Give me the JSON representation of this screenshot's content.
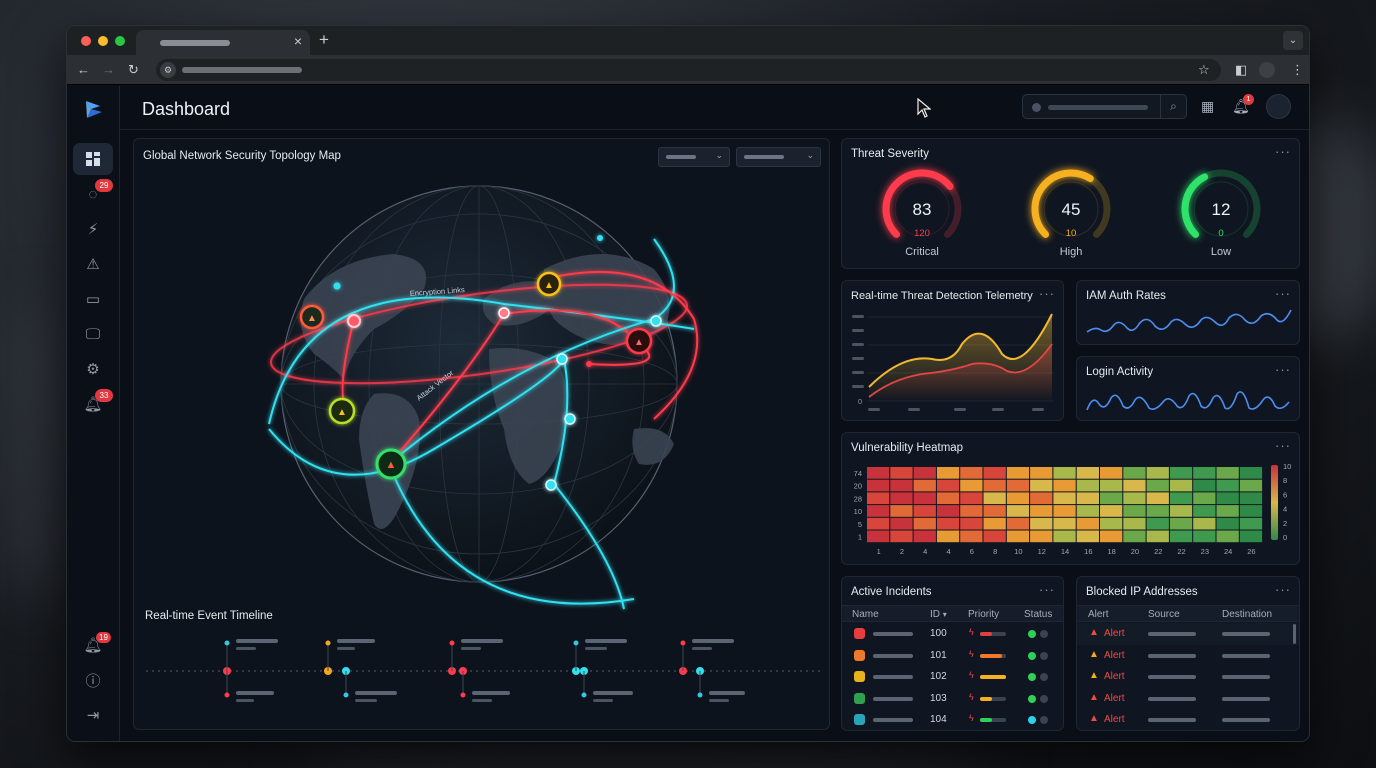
{
  "app": {
    "page_title": "Dashboard"
  },
  "sidebar": {
    "badges": {
      "shield": "29",
      "bell": "33",
      "notifications": "19"
    }
  },
  "header": {
    "notification_badge": "1"
  },
  "map": {
    "title": "Global Network Security Topology Map",
    "annotation_1": "Encryption Links",
    "annotation_2": "Attack Vector"
  },
  "timeline": {
    "title": "Real-time Event Timeline"
  },
  "severity": {
    "title": "Threat Severity",
    "gauges": [
      {
        "label": "Critical",
        "value": "83",
        "sub": "120",
        "fraction": 0.69,
        "color": "#ff3b4c"
      },
      {
        "label": "High",
        "value": "45",
        "sub": "10",
        "fraction": 0.62,
        "color": "#f7b01f"
      },
      {
        "label": "Low",
        "value": "12",
        "sub": "0",
        "fraction": 0.4,
        "color": "#2ee36a"
      }
    ]
  },
  "telemetry": {
    "title": "Real-time Threat Detection Telemetry",
    "y_ticks": [
      "0"
    ]
  },
  "iam": {
    "title": "IAM Auth Rates"
  },
  "login": {
    "title": "Login Activity"
  },
  "heatmap": {
    "title": "Vulnerability Heatmap",
    "y_labels": [
      "74",
      "20",
      "28",
      "10",
      "5",
      "1"
    ],
    "x_labels": [
      "1",
      "2",
      "4",
      "4",
      "6",
      "8",
      "10",
      "12",
      "14",
      "16",
      "18",
      "20",
      "22",
      "22",
      "23",
      "24",
      "26"
    ],
    "scale_labels": [
      "10",
      "8",
      "6",
      "4",
      "2",
      "0"
    ]
  },
  "incidents": {
    "title": "Active Incidents",
    "columns": {
      "name": "Name",
      "id": "ID",
      "priority": "Priority",
      "status": "Status"
    },
    "sort_indicator": "▾",
    "rows": [
      {
        "id": "100",
        "icon_color": "#e53e3e",
        "bar_color": "#e53e3e",
        "bar": 0.45,
        "status": "#2ed158"
      },
      {
        "id": "101",
        "icon_color": "#ed7a2a",
        "bar_color": "#ed7a2a",
        "bar": 0.85,
        "status": "#2ed158"
      },
      {
        "id": "102",
        "icon_color": "#e8b21f",
        "bar_color": "#f7b01f",
        "bar": 1.0,
        "status": "#2ed158"
      },
      {
        "id": "103",
        "icon_color": "#2ea04f",
        "bar_color": "#f7b01f",
        "bar": 0.45,
        "status": "#2ed158"
      },
      {
        "id": "104",
        "icon_color": "#2aa3b8",
        "bar_color": "#2ed158",
        "bar": 0.45,
        "status": "#2ad4e8"
      }
    ]
  },
  "blocked": {
    "title": "Blocked IP Addresses",
    "columns": {
      "alert": "Alert",
      "source": "Source",
      "destination": "Destination"
    },
    "rows": [
      {
        "alert": "Alert",
        "icon_color": "#f04a45"
      },
      {
        "alert": "Alert",
        "icon_color": "#f7a81f"
      },
      {
        "alert": "Alert",
        "icon_color": "#f7a81f"
      },
      {
        "alert": "Alert",
        "icon_color": "#f04a45"
      },
      {
        "alert": "Alert",
        "icon_color": "#f04a45"
      }
    ]
  }
}
